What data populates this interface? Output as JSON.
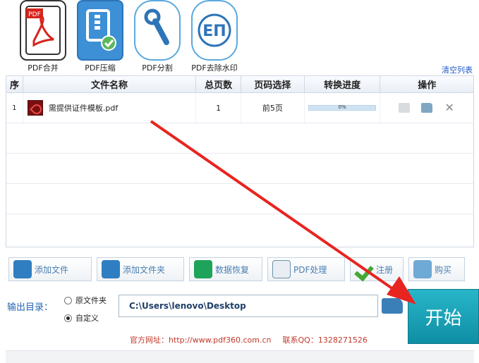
{
  "tools": [
    {
      "label": "PDF合并",
      "icon": "pdf-merge-icon",
      "badge": "PDF"
    },
    {
      "label": "PDF压缩",
      "icon": "pdf-compress-icon"
    },
    {
      "label": "PDF分割",
      "icon": "pdf-split-icon"
    },
    {
      "label": "PDF去除水印",
      "icon": "pdf-watermark-remove-icon",
      "badge": "EП"
    }
  ],
  "clear_list": "清空列表",
  "table": {
    "headers": [
      "序",
      "文件名称",
      "总页数",
      "页码选择",
      "转换进度",
      "操作"
    ],
    "rows": [
      {
        "index": "1",
        "filename": "需提供证件模板.pdf",
        "pages": "1",
        "page_range": "前5页",
        "progress_text": "0%",
        "progress": 0
      }
    ]
  },
  "actions": [
    "添加文件",
    "添加文件夹",
    "数据恢复",
    "PDF处理",
    "注册",
    "购买"
  ],
  "output": {
    "label": "输出目录：",
    "option_original": "原文件夹",
    "option_custom": "自定义",
    "selected": "custom",
    "path": "C:\\Users\\lenovo\\Desktop"
  },
  "start_label": "开始",
  "footer": {
    "website": "官方网址：http://www.pdf360.com.cn",
    "qq": "联系QQ：1328271526"
  },
  "colors": {
    "accent": "#2f7ec2",
    "start": "#1aa2b6",
    "arrow": "#e82420"
  }
}
